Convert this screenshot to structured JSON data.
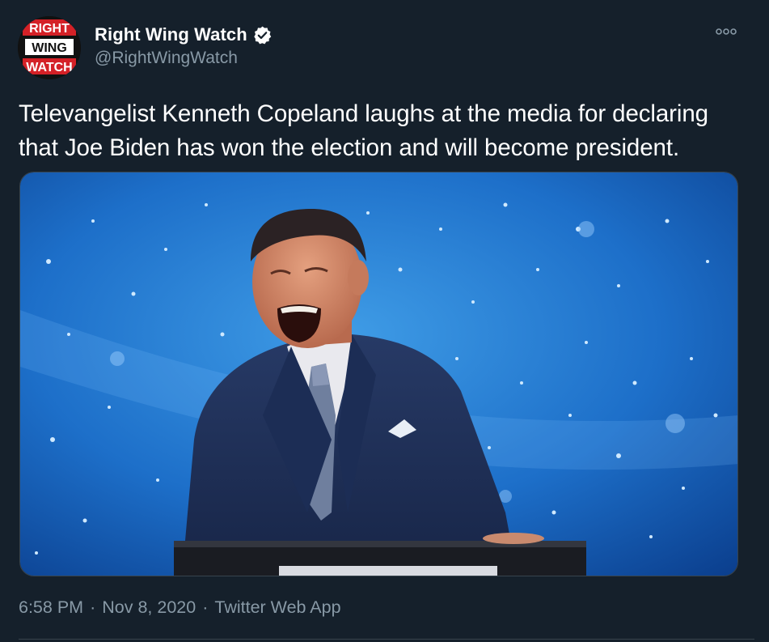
{
  "author": {
    "display_name": "Right Wing Watch",
    "handle": "@RightWingWatch",
    "avatar_lines": [
      "RIGHT",
      "WING",
      "WATCH"
    ],
    "avatar_icon": "right-wing-watch-logo",
    "verified_icon": "verified-badge-icon"
  },
  "menu": {
    "icon": "more-options-icon"
  },
  "tweet": {
    "text": "Televangelist Kenneth Copeland laughs at the media for declaring that Joe Biden has won the election and will become president."
  },
  "media": {
    "type": "video-thumbnail"
  },
  "meta": {
    "time": "6:58 PM",
    "separator": "·",
    "date": "Nov 8, 2020",
    "source": "Twitter Web App"
  },
  "colors": {
    "background": "#15202b",
    "text_primary": "#ffffff",
    "text_secondary": "#8899a6",
    "border": "#38444d",
    "logo_red": "#d42127"
  }
}
